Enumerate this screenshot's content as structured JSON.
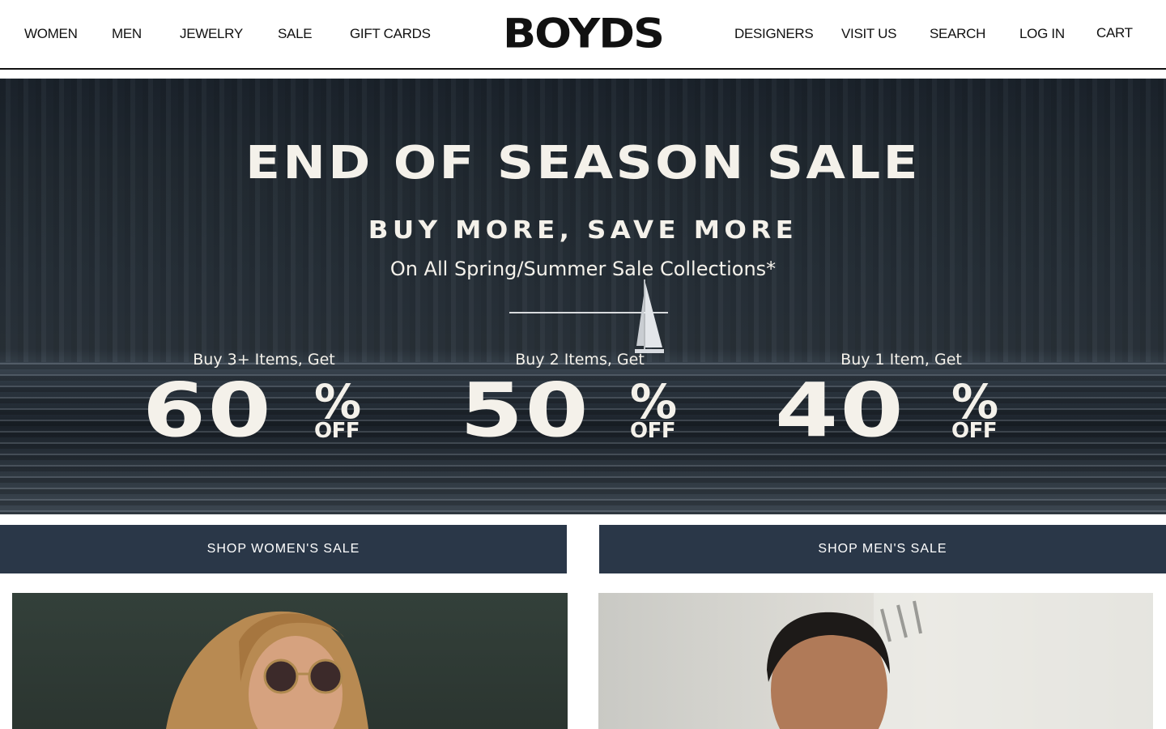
{
  "header": {
    "nav_left": [
      "WOMEN",
      "MEN",
      "JEWELRY",
      "SALE",
      "GIFT CARDS"
    ],
    "logo": "BOYDS",
    "nav_right": [
      "DESIGNERS",
      "VISIT US",
      "SEARCH",
      "LOG IN",
      "CART"
    ]
  },
  "hero": {
    "title": "END OF SEASON SALE",
    "subtitle": "BUY MORE, SAVE MORE",
    "note": "On All Spring/Summer Sale Collections*",
    "offers": [
      {
        "label": "Buy 3+ Items, Get",
        "percent": "60",
        "pct_sign": "%",
        "off": "OFF"
      },
      {
        "label": "Buy 2 Items, Get",
        "percent": "50",
        "pct_sign": "%",
        "off": "OFF"
      },
      {
        "label": "Buy 1 Item, Get",
        "percent": "40",
        "pct_sign": "%",
        "off": "OFF"
      }
    ]
  },
  "buttons": {
    "women_sale": "SHOP WOMEN'S SALE",
    "men_sale": "SHOP MEN'S SALE"
  },
  "colors": {
    "button_bg": "#2a3748",
    "hero_text": "#f4f1ea"
  }
}
